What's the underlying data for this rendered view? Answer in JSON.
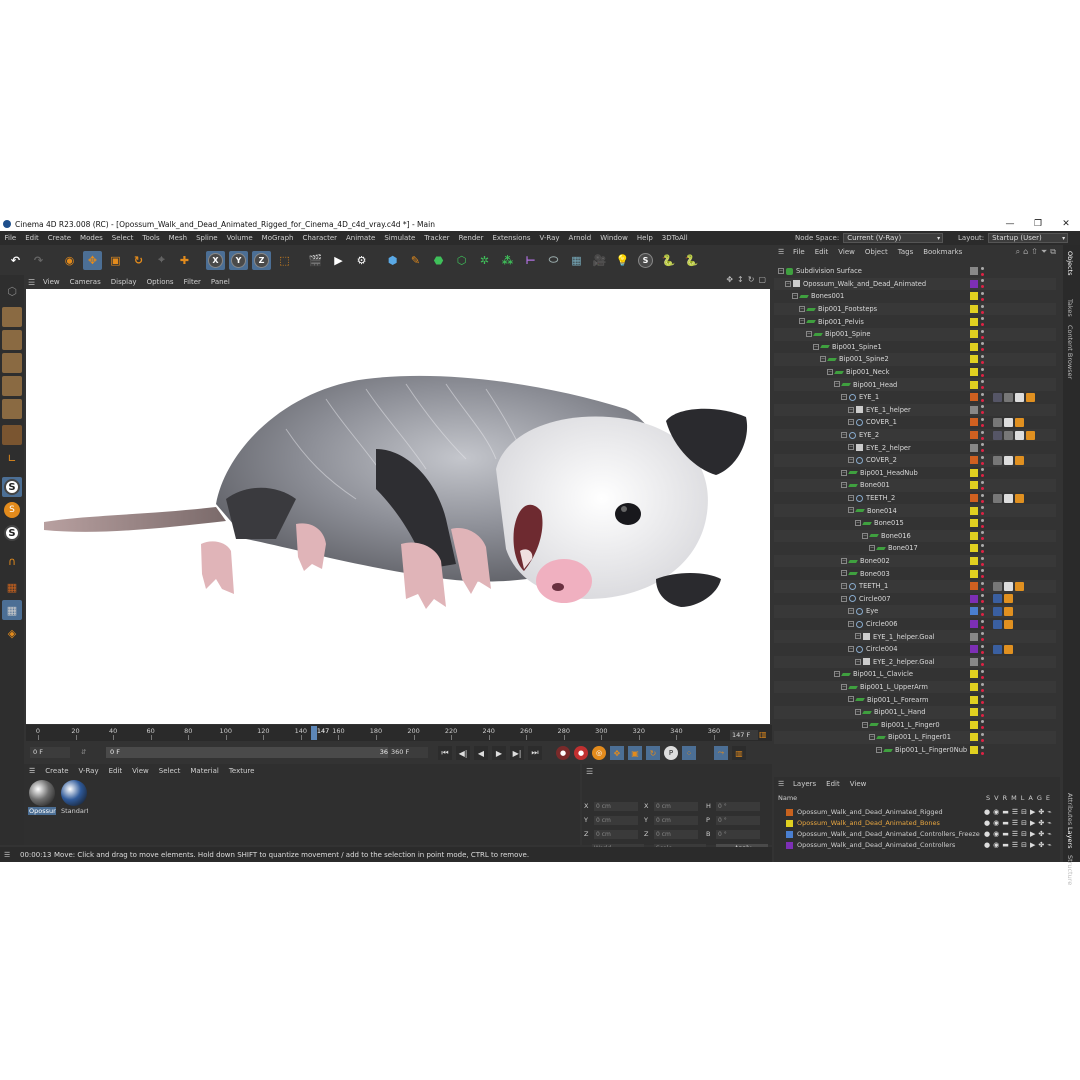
{
  "window": {
    "title": "Cinema 4D R23.008 (RC) - [Opossum_Walk_and_Dead_Animated_Rigged_for_Cinema_4D_c4d_vray.c4d *] - Main",
    "minimize": "—",
    "maximize": "❐",
    "close": "✕"
  },
  "menubar": [
    "File",
    "Edit",
    "Create",
    "Modes",
    "Select",
    "Tools",
    "Mesh",
    "Spline",
    "Volume",
    "MoGraph",
    "Character",
    "Animate",
    "Simulate",
    "Tracker",
    "Render",
    "Extensions",
    "V-Ray",
    "Arnold",
    "Window",
    "Help",
    "3DToAll"
  ],
  "nodespace": {
    "label": "Node Space:",
    "value": "Current (V-Ray)"
  },
  "layout": {
    "label": "Layout:",
    "value": "Startup (User)"
  },
  "toolbar": {
    "axis_x": "X",
    "axis_y": "Y",
    "axis_z": "Z"
  },
  "viewport": {
    "menu": [
      "View",
      "Cameras",
      "Display",
      "Options",
      "Filter",
      "Panel"
    ]
  },
  "timeline": {
    "ticks": [
      "0",
      "20",
      "40",
      "60",
      "80",
      "100",
      "120",
      "140",
      "160",
      "180",
      "200",
      "220",
      "240",
      "260",
      "280",
      "300",
      "320",
      "340",
      "360"
    ],
    "current_marker": "147",
    "current_frame": "147 F"
  },
  "transport": {
    "start": "0 F",
    "range_start": "0 F",
    "range_end": "360 F",
    "end": "360 F"
  },
  "material": {
    "menu": [
      "Create",
      "V-Ray",
      "Edit",
      "View",
      "Select",
      "Material",
      "Texture"
    ],
    "items": [
      {
        "label": "Opossur",
        "color": "#6e6e6e",
        "selected": true
      },
      {
        "label": "Standart",
        "color": "#2f5a9a",
        "selected": false
      }
    ]
  },
  "coordinates": {
    "x_pos": "0 cm",
    "y_pos": "0 cm",
    "z_pos": "0 cm",
    "x_size": "0 cm",
    "y_size": "0 cm",
    "z_size": "0 cm",
    "h": "0 °",
    "p": "0 °",
    "b": "0 °",
    "mode1": "World",
    "mode2": "Scale",
    "apply": "Apply"
  },
  "status": {
    "time": "00:00:13",
    "message": "Move: Click and drag to move elements. Hold down SHIFT to quantize movement / add to the selection in point mode, CTRL to remove."
  },
  "objects": {
    "menu": [
      "File",
      "Edit",
      "View",
      "Object",
      "Tags",
      "Bookmarks"
    ],
    "rows": [
      {
        "name": "Subdivision Surface",
        "indent": 0,
        "icon": "sub",
        "color": "#888888",
        "tags": []
      },
      {
        "name": "Opossum_Walk_and_Dead_Animated",
        "indent": 1,
        "icon": "target",
        "color": "#7d2fb5",
        "tags": []
      },
      {
        "name": "Bones001",
        "indent": 2,
        "icon": "bone",
        "color": "#e0d020",
        "tags": []
      },
      {
        "name": "Bip001_Footsteps",
        "indent": 3,
        "icon": "bone",
        "color": "#e0d020",
        "tags": []
      },
      {
        "name": "Bip001_Pelvis",
        "indent": 3,
        "icon": "bone",
        "color": "#e0d020",
        "tags": []
      },
      {
        "name": "Bip001_Spine",
        "indent": 4,
        "icon": "bone",
        "color": "#e0d020",
        "tags": []
      },
      {
        "name": "Bip001_Spine1",
        "indent": 5,
        "icon": "bone",
        "color": "#e0d020",
        "tags": []
      },
      {
        "name": "Bip001_Spine2",
        "indent": 6,
        "icon": "bone",
        "color": "#e0d020",
        "tags": []
      },
      {
        "name": "Bip001_Neck",
        "indent": 7,
        "icon": "bone",
        "color": "#e0d020",
        "tags": []
      },
      {
        "name": "Bip001_Head",
        "indent": 8,
        "icon": "bone",
        "color": "#e0d020",
        "tags": []
      },
      {
        "name": "EYE_1",
        "indent": 9,
        "icon": "null",
        "color": "#d06020",
        "tags": [
          "#556",
          "#777",
          "#ddd",
          "#e09020"
        ]
      },
      {
        "name": "EYE_1_helper",
        "indent": 10,
        "icon": "target",
        "color": "#888888",
        "tags": []
      },
      {
        "name": "COVER_1",
        "indent": 10,
        "icon": "null",
        "color": "#d06020",
        "tags": [
          "#777",
          "#ddd",
          "#e09020"
        ]
      },
      {
        "name": "EYE_2",
        "indent": 9,
        "icon": "null",
        "color": "#d06020",
        "tags": [
          "#556",
          "#777",
          "#ddd",
          "#e09020"
        ]
      },
      {
        "name": "EYE_2_helper",
        "indent": 10,
        "icon": "target",
        "color": "#888888",
        "tags": []
      },
      {
        "name": "COVER_2",
        "indent": 10,
        "icon": "null",
        "color": "#d06020",
        "tags": [
          "#777",
          "#ddd",
          "#e09020"
        ]
      },
      {
        "name": "Bip001_HeadNub",
        "indent": 9,
        "icon": "bone",
        "color": "#e0d020",
        "tags": []
      },
      {
        "name": "Bone001",
        "indent": 9,
        "icon": "bone",
        "color": "#e0d020",
        "tags": []
      },
      {
        "name": "TEETH_2",
        "indent": 10,
        "icon": "null",
        "color": "#d06020",
        "tags": [
          "#777",
          "#ddd",
          "#e09020"
        ]
      },
      {
        "name": "Bone014",
        "indent": 10,
        "icon": "bone",
        "color": "#e0d020",
        "tags": []
      },
      {
        "name": "Bone015",
        "indent": 11,
        "icon": "bone",
        "color": "#e0d020",
        "tags": []
      },
      {
        "name": "Bone016",
        "indent": 12,
        "icon": "bone",
        "color": "#e0d020",
        "tags": []
      },
      {
        "name": "Bone017",
        "indent": 13,
        "icon": "bone",
        "color": "#e0d020",
        "tags": []
      },
      {
        "name": "Bone002",
        "indent": 9,
        "icon": "bone",
        "color": "#e0d020",
        "tags": []
      },
      {
        "name": "Bone003",
        "indent": 9,
        "icon": "bone",
        "color": "#e0d020",
        "tags": []
      },
      {
        "name": "TEETH_1",
        "indent": 9,
        "icon": "null",
        "color": "#d06020",
        "tags": [
          "#777",
          "#ddd",
          "#e09020"
        ]
      },
      {
        "name": "Circle007",
        "indent": 9,
        "icon": "null",
        "color": "#7d2fb5",
        "tags": [
          "#3a5fa0",
          "#e09020"
        ]
      },
      {
        "name": "Eye",
        "indent": 10,
        "icon": "null",
        "color": "#4a7fd0",
        "tags": [
          "#3a5fa0",
          "#e09020"
        ]
      },
      {
        "name": "Circle006",
        "indent": 10,
        "icon": "null",
        "color": "#7d2fb5",
        "tags": [
          "#3a5fa0",
          "#e09020"
        ]
      },
      {
        "name": "EYE_1_helper.Goal",
        "indent": 11,
        "icon": "target",
        "color": "#888888",
        "tags": []
      },
      {
        "name": "Circle004",
        "indent": 10,
        "icon": "null",
        "color": "#7d2fb5",
        "tags": [
          "#3a5fa0",
          "#e09020"
        ]
      },
      {
        "name": "EYE_2_helper.Goal",
        "indent": 11,
        "icon": "target",
        "color": "#888888",
        "tags": []
      },
      {
        "name": "Bip001_L_Clavicle",
        "indent": 8,
        "icon": "bone",
        "color": "#e0d020",
        "tags": []
      },
      {
        "name": "Bip001_L_UpperArm",
        "indent": 9,
        "icon": "bone",
        "color": "#e0d020",
        "tags": []
      },
      {
        "name": "Bip001_L_Forearm",
        "indent": 10,
        "icon": "bone",
        "color": "#e0d020",
        "tags": []
      },
      {
        "name": "Bip001_L_Hand",
        "indent": 11,
        "icon": "bone",
        "color": "#e0d020",
        "tags": []
      },
      {
        "name": "Bip001_L_Finger0",
        "indent": 12,
        "icon": "bone",
        "color": "#e0d020",
        "tags": []
      },
      {
        "name": "Bip001_L_Finger01",
        "indent": 13,
        "icon": "bone",
        "color": "#e0d020",
        "tags": []
      },
      {
        "name": "Bip001_L_Finger0Nub",
        "indent": 14,
        "icon": "bone",
        "color": "#e0d020",
        "tags": []
      }
    ]
  },
  "layers": {
    "menu": [
      "Layers",
      "Edit",
      "View"
    ],
    "header_name": "Name",
    "columns": [
      "S",
      "V",
      "R",
      "M",
      "L",
      "A",
      "G",
      "E"
    ],
    "rows": [
      {
        "name": "Opossum_Walk_and_Dead_Animated_Rigged",
        "color": "#c8621e",
        "active": false
      },
      {
        "name": "Opossum_Walk_and_Dead_Animated_Bones",
        "color": "#e0d020",
        "active": true
      },
      {
        "name": "Opossum_Walk_and_Dead_Animated_Controllers_Freeze",
        "color": "#4a7fd0",
        "active": false
      },
      {
        "name": "Opossum_Walk_and_Dead_Animated_Controllers",
        "color": "#7d2fb5",
        "active": false
      }
    ]
  },
  "sidetabs": [
    "Objects",
    "Takes",
    "Content Browser",
    "Attributes",
    "Layers",
    "Structure"
  ]
}
